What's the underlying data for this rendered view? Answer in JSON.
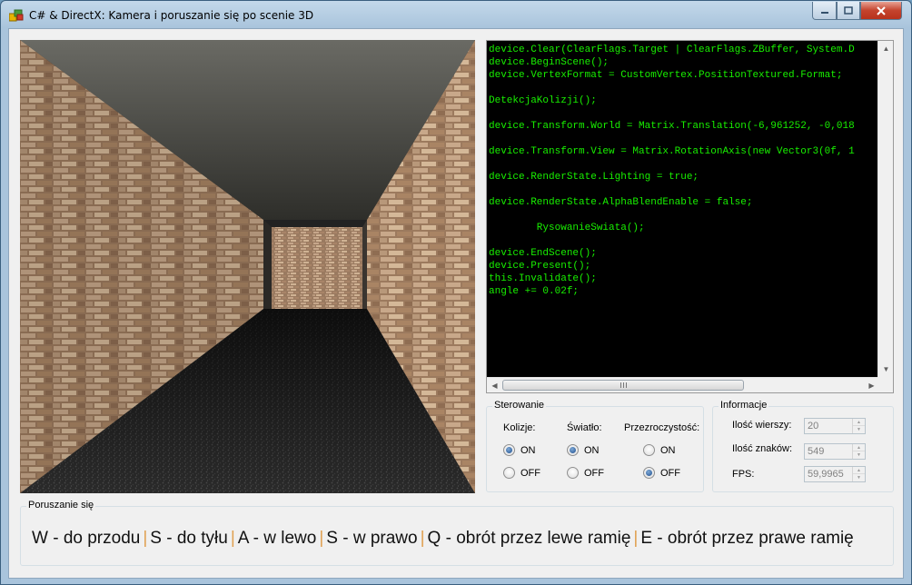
{
  "window": {
    "title": "C# & DirectX: Kamera i poruszanie się po scenie 3D"
  },
  "code": {
    "lines": [
      "device.Clear(ClearFlags.Target | ClearFlags.ZBuffer, System.D",
      "device.BeginScene();",
      "device.VertexFormat = CustomVertex.PositionTextured.Format;",
      "",
      "DetekcjaKolizji();",
      "",
      "device.Transform.World = Matrix.Translation(-6,961252, -0,018",
      "",
      "device.Transform.View = Matrix.RotationAxis(new Vector3(0f, 1",
      "",
      "device.RenderState.Lighting = true;",
      "",
      "device.RenderState.AlphaBlendEnable = false;",
      "",
      "        RysowanieSwiata();",
      "",
      "device.EndScene();",
      "device.Present();",
      "this.Invalidate();",
      "angle += 0.02f;"
    ],
    "scroll_arrows": {
      "left": "◀",
      "right": "▶",
      "up": "▲",
      "down": "▼"
    }
  },
  "sterowanie": {
    "title": "Sterowanie",
    "kolizje": {
      "label": "Kolizje:",
      "on": "ON",
      "off": "OFF",
      "selected": "ON"
    },
    "swiatlo": {
      "label": "Światło:",
      "on": "ON",
      "off": "OFF",
      "selected": "ON"
    },
    "przezroczystosc": {
      "label": "Przezroczystość:",
      "on": "ON",
      "off": "OFF",
      "selected": "OFF"
    }
  },
  "informacje": {
    "title": "Informacje",
    "wiersze": {
      "label": "Ilość wierszy:",
      "value": "20"
    },
    "znaki": {
      "label": "Ilość znaków:",
      "value": "549"
    },
    "fps": {
      "label": "FPS:",
      "value": "59,9965"
    }
  },
  "poruszanie": {
    "title": "Poruszanie się",
    "keys": [
      "W - do przodu",
      "S - do tyłu",
      "A - w lewo",
      "S - w prawo",
      "Q - obrót przez lewe ramię",
      "E - obrót przez prawe ramię"
    ],
    "separator": "|"
  },
  "colors": {
    "code_text": "#18f000",
    "code_bg": "#000000",
    "separator": "#e0a050"
  }
}
